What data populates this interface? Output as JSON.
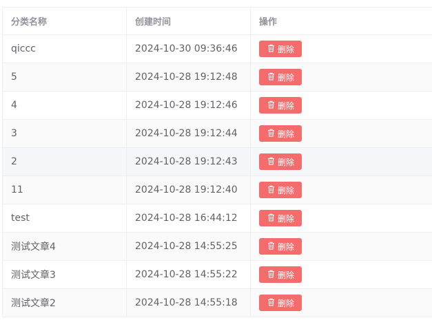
{
  "table": {
    "columns": [
      "分类名称",
      "创建时间",
      "操作"
    ],
    "delete_label": "删除",
    "delete_icon": "trash-icon",
    "rows": [
      {
        "name": "qiccc",
        "created": "2024-10-30 09:36:46"
      },
      {
        "name": "5",
        "created": "2024-10-28 19:12:48"
      },
      {
        "name": "4",
        "created": "2024-10-28 19:12:46"
      },
      {
        "name": "3",
        "created": "2024-10-28 19:12:44"
      },
      {
        "name": "2",
        "created": "2024-10-28 19:12:43"
      },
      {
        "name": "11",
        "created": "2024-10-28 19:12:40"
      },
      {
        "name": "test",
        "created": "2024-10-28 16:44:12"
      },
      {
        "name": "测试文章4",
        "created": "2024-10-28 14:55:25"
      },
      {
        "name": "测试文章3",
        "created": "2024-10-28 14:55:22"
      },
      {
        "name": "测试文章2",
        "created": "2024-10-28 14:55:18"
      }
    ]
  },
  "colors": {
    "danger": "#f56c6c",
    "header_text": "#909399",
    "body_text": "#606266"
  }
}
